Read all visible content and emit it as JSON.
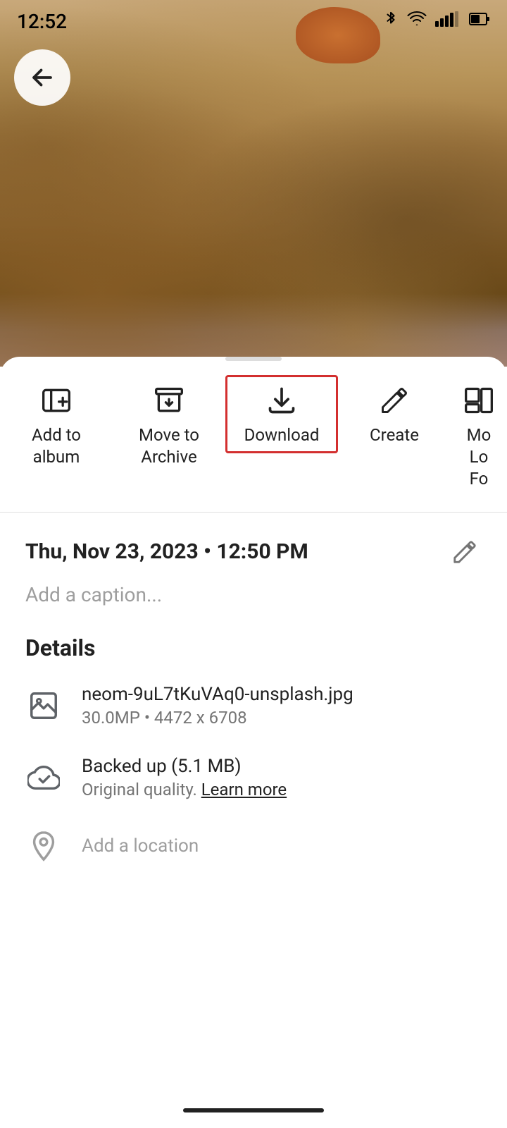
{
  "statusBar": {
    "time": "12:52",
    "icons": [
      "bluetooth",
      "wifi",
      "signal",
      "battery"
    ]
  },
  "backButton": {
    "label": "back"
  },
  "actionBar": {
    "items": [
      {
        "id": "add-to-album",
        "label": "Add to\nalbum",
        "icon": "add-to-album-icon"
      },
      {
        "id": "move-to-archive",
        "label": "Move to\nArchive",
        "icon": "archive-icon"
      },
      {
        "id": "download",
        "label": "Download",
        "icon": "download-icon",
        "highlighted": true
      },
      {
        "id": "create",
        "label": "Create",
        "icon": "create-icon"
      },
      {
        "id": "more",
        "label": "Mo\nLo\nFo",
        "icon": "more-icon",
        "partial": true
      }
    ]
  },
  "photoInfo": {
    "date": "Thu, Nov 23, 2023 • 12:50 PM",
    "captionPlaceholder": "Add a caption..."
  },
  "details": {
    "heading": "Details",
    "items": [
      {
        "id": "file-info",
        "icon": "image-icon",
        "primary": "neom-9uL7tKuVAq0-unsplash.jpg",
        "secondary": "30.0MP  •  4472 x 6708"
      },
      {
        "id": "backup-info",
        "icon": "cloud-done-icon",
        "primary": "Backed up (5.1 MB)",
        "secondary_text": "Original quality.",
        "secondary_link": "Learn more"
      },
      {
        "id": "location-info",
        "icon": "location-icon",
        "primary": "Add a location",
        "isMuted": true
      }
    ]
  },
  "homeIndicator": {}
}
